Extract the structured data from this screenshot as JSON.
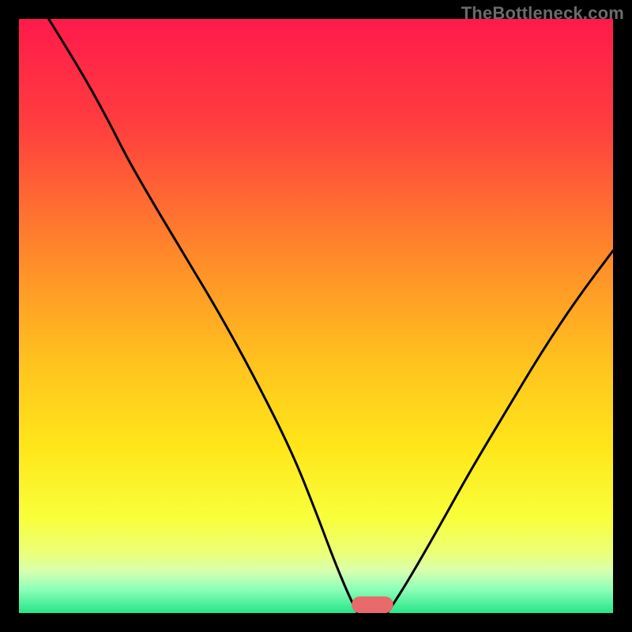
{
  "watermark": "TheBottleneck.com",
  "chart_data": {
    "type": "line",
    "title": "",
    "xlabel": "",
    "ylabel": "",
    "xlim": [
      0,
      100
    ],
    "ylim": [
      0,
      100
    ],
    "grid": false,
    "legend": false,
    "background_gradient_stops": [
      {
        "offset": 0,
        "color": "#ff1a4b"
      },
      {
        "offset": 18,
        "color": "#ff3e3e"
      },
      {
        "offset": 40,
        "color": "#ff8a2a"
      },
      {
        "offset": 58,
        "color": "#ffc31e"
      },
      {
        "offset": 72,
        "color": "#ffe61a"
      },
      {
        "offset": 84,
        "color": "#f8ff3a"
      },
      {
        "offset": 90,
        "color": "#ecff7a"
      },
      {
        "offset": 93,
        "color": "#d6ffb0"
      },
      {
        "offset": 96,
        "color": "#8dffb8"
      },
      {
        "offset": 100,
        "color": "#26e58a"
      }
    ],
    "series": [
      {
        "name": "curve-left",
        "x": [
          5,
          10,
          15,
          18,
          22,
          28,
          34,
          40,
          46,
          50,
          53,
          55.5,
          57
        ],
        "y": [
          100,
          92,
          83,
          77,
          70,
          60,
          50,
          39,
          27,
          17,
          9,
          3,
          0
        ]
      },
      {
        "name": "curve-right",
        "x": [
          62,
          64,
          67,
          71,
          76,
          82,
          88,
          94,
          100
        ],
        "y": [
          0,
          3,
          8,
          15,
          24,
          34,
          44,
          53,
          61
        ]
      }
    ],
    "marker": {
      "name": "bottom-pill",
      "x_center": 59.5,
      "width": 7,
      "height": 2.8,
      "color": "#e96a6a"
    }
  }
}
